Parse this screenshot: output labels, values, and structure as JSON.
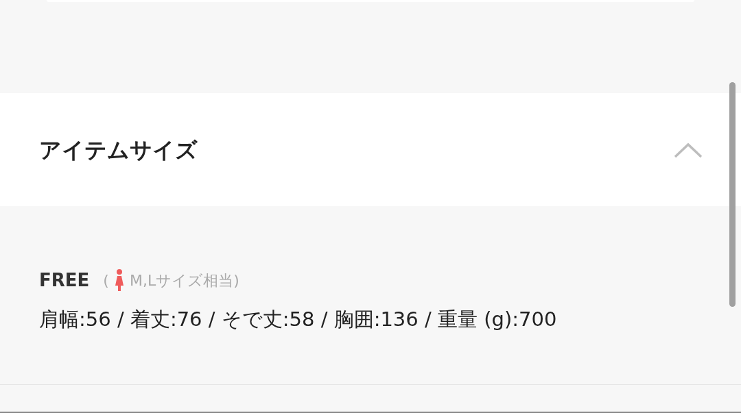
{
  "section": {
    "title": "アイテムサイズ",
    "expanded": true
  },
  "sizes": [
    {
      "name": "FREE",
      "open_paren": "(",
      "equivalent": "M,Lサイズ相当)",
      "measurements": "肩幅:56 / 着丈:76 / そで丈:58 / 胸囲:136 / 重量 (g):700"
    }
  ]
}
